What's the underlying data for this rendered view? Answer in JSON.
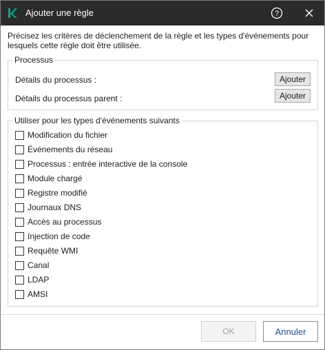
{
  "dialog": {
    "title": "Ajouter une règle",
    "intro": "Précisez les critères de déclenchement de la règle et les types d'événements pour lesquels cette règle doit être utilisée."
  },
  "icons": {
    "app": "kaspersky-k-icon",
    "help": "help-circle-icon",
    "close": "close-icon",
    "accent": "#00a88e"
  },
  "process_group": {
    "legend": "Processus",
    "process_details_label": "Détails du processus :",
    "parent_details_label": "Détails du processus parent :",
    "add_label": "Ajouter"
  },
  "events_group": {
    "legend": "Utiliser pour les types d'événements suivants",
    "items": [
      {
        "label": "Modification du fichier",
        "checked": false
      },
      {
        "label": "Événements du réseau",
        "checked": false
      },
      {
        "label": "Processus : entrée interactive de la console",
        "checked": false
      },
      {
        "label": "Module chargé",
        "checked": false
      },
      {
        "label": "Registre modifié",
        "checked": false
      },
      {
        "label": "Journaux DNS",
        "checked": false
      },
      {
        "label": "Accès au processus",
        "checked": false
      },
      {
        "label": "Injection de code",
        "checked": false
      },
      {
        "label": "Requête WMI",
        "checked": false
      },
      {
        "label": "Canal",
        "checked": false
      },
      {
        "label": "LDAP",
        "checked": false
      },
      {
        "label": "AMSI",
        "checked": false
      }
    ]
  },
  "footer": {
    "ok_label": "OK",
    "ok_enabled": false,
    "cancel_label": "Annuler",
    "cancel_color": "#1a4f8a"
  }
}
